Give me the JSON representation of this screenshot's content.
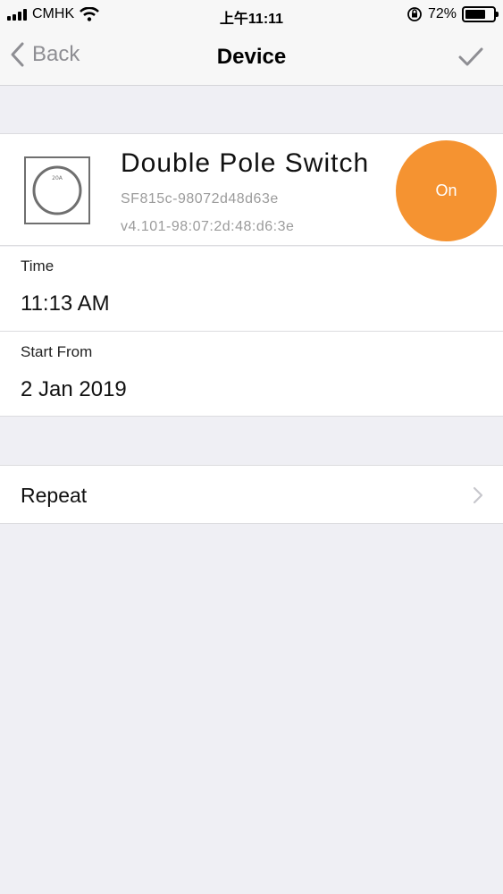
{
  "status_bar": {
    "carrier": "CMHK",
    "time": "上午11:11",
    "battery_percent": "72%",
    "battery_level": 0.72
  },
  "nav": {
    "back_label": "Back",
    "title": "Device"
  },
  "device": {
    "name": "Double Pole Switch",
    "model_id": "SF815c-98072d48d63e",
    "version": "v4.101-98:07:2d:48:d6:3e",
    "thumb_label": "20A",
    "power_button_label": "On",
    "power_button_color": "#f59331"
  },
  "schedule": {
    "time_label": "Time",
    "time_value": "11:13 AM",
    "start_label": "Start From",
    "start_value": "2 Jan 2019"
  },
  "repeat": {
    "label": "Repeat"
  }
}
